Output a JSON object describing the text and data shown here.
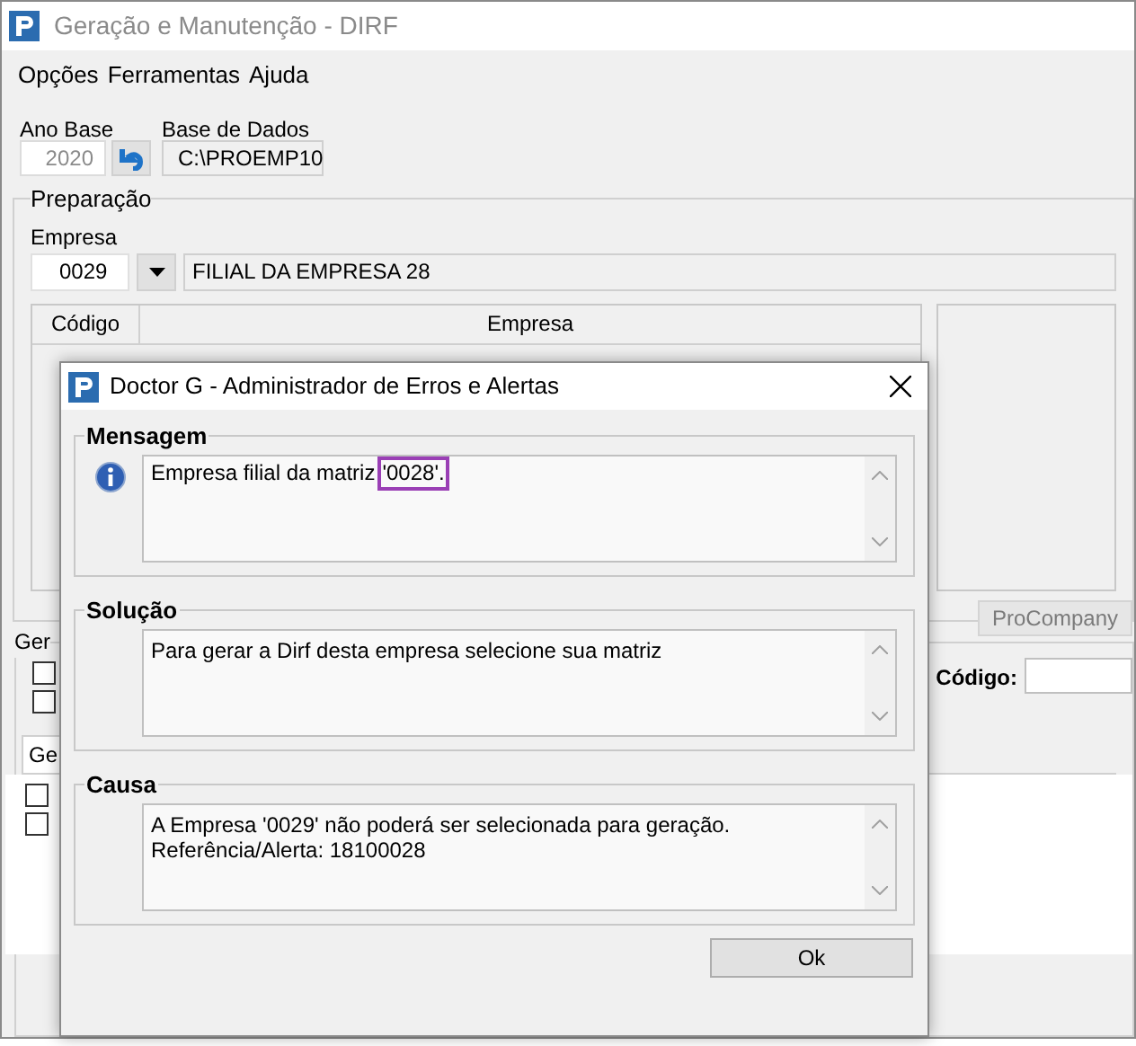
{
  "window": {
    "title": "Geração e Manutenção - DIRF"
  },
  "menu": [
    {
      "label": "Opções"
    },
    {
      "label": "Ferramentas"
    },
    {
      "label": "Ajuda"
    }
  ],
  "ano_base": {
    "label": "Ano Base",
    "value": "2020",
    "disabled": true
  },
  "base_de_dados": {
    "label": "Base de Dados",
    "value": "C:\\PROEMP10"
  },
  "preparacao": {
    "title": "Preparação",
    "empresa_label": "Empresa",
    "empresa_code": "0029",
    "empresa_name": "FILIAL DA EMPRESA 28",
    "table": {
      "columns": [
        "Código",
        "Empresa"
      ]
    },
    "procompany_button": {
      "label": "ProCompany"
    }
  },
  "group_2": {
    "title": "Ger",
    "checkboxes": [
      {
        "checked": false
      },
      {
        "checked": false
      }
    ],
    "codigo_label": "Código:",
    "tab": "Ge",
    "tab_checkboxes": [
      {
        "checked": false
      },
      {
        "checked": false
      }
    ]
  },
  "dialog": {
    "title": "Doctor G - Administrador de Erros e Alertas",
    "sections": [
      {
        "title": "Mensagem",
        "kind": "info",
        "lines": [
          "Empresa filial da matriz"
        ],
        "highlighted": "'0028'."
      },
      {
        "title": "Solução",
        "kind": "plain",
        "lines": [
          "Para gerar a Dirf desta empresa selecione sua matriz"
        ]
      },
      {
        "title": "Causa",
        "kind": "plain",
        "lines": [
          "A Empresa '0029' não poderá ser selecionada para geração.",
          "Referência/Alerta: 18100028"
        ]
      }
    ],
    "ok_button": {
      "label": "Ok"
    }
  }
}
